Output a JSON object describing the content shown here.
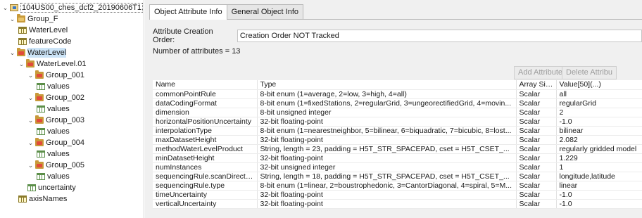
{
  "tree": {
    "root": "104US00_ches_dcf2_20190606T1",
    "group_f": "Group_F",
    "group_f_children": [
      "WaterLevel",
      "featureCode"
    ],
    "waterlevel": "WaterLevel",
    "waterlevel01": "WaterLevel.01",
    "groups": [
      {
        "label": "Group_001",
        "child": "values"
      },
      {
        "label": "Group_002",
        "child": "values"
      },
      {
        "label": "Group_003",
        "child": "values"
      },
      {
        "label": "Group_004",
        "child": "values"
      },
      {
        "label": "Group_005",
        "child": "values"
      }
    ],
    "uncertainty": "uncertainty",
    "axisnames": "axisNames"
  },
  "tabs": [
    "Object Attribute Info",
    "General Object Info"
  ],
  "attributes_panel": {
    "order_label": "Attribute Creation Order:",
    "order_value": "Creation Order NOT Tracked",
    "count_text": "Number of attributes = 13",
    "add_button": "Add Attribute",
    "delete_button": "Delete Attribu"
  },
  "table": {
    "headers": [
      "Name",
      "Type",
      "Array Size",
      "Value[50](...)"
    ],
    "rows": [
      [
        "commonPointRule",
        "8-bit enum (1=average, 2=low, 3=high, 4=all)",
        "Scalar",
        "all"
      ],
      [
        "dataCodingFormat",
        "8-bit enum (1=fixedStations, 2=regularGrid, 3=ungeorectifiedGrid, 4=movin...",
        "Scalar",
        "regularGrid"
      ],
      [
        "dimension",
        "8-bit unsigned integer",
        "Scalar",
        "2"
      ],
      [
        "horizontalPositionUncertainty",
        "32-bit floating-point",
        "Scalar",
        "-1.0"
      ],
      [
        "interpolationType",
        "8-bit enum (1=nearestneighbor, 5=bilinear, 6=biquadratic, 7=bicubic, 8=lost...",
        "Scalar",
        "bilinear"
      ],
      [
        "maxDatasetHeight",
        "32-bit floating-point",
        "Scalar",
        "2.082"
      ],
      [
        "methodWaterLevelProduct",
        "String, length = 23, padding = H5T_STR_SPACEPAD, cset = H5T_CSET_...",
        "Scalar",
        "regularly gridded model"
      ],
      [
        "minDatasetHeight",
        "32-bit floating-point",
        "Scalar",
        "1.229"
      ],
      [
        "numInstances",
        "32-bit unsigned integer",
        "Scalar",
        "1"
      ],
      [
        "sequencingRule.scanDirection",
        "String, length = 18, padding = H5T_STR_SPACEPAD, cset = H5T_CSET_...",
        "Scalar",
        "longitude,latitude"
      ],
      [
        "sequencingRule.type",
        "8-bit enum (1=linear, 2=boustrophedonic, 3=CantorDiagonal, 4=spiral, 5=M...",
        "Scalar",
        "linear"
      ],
      [
        "timeUncertainty",
        "32-bit floating-point",
        "Scalar",
        "-1.0"
      ],
      [
        "verticalUncertainty",
        "32-bit floating-point",
        "Scalar",
        "-1.0"
      ]
    ]
  }
}
